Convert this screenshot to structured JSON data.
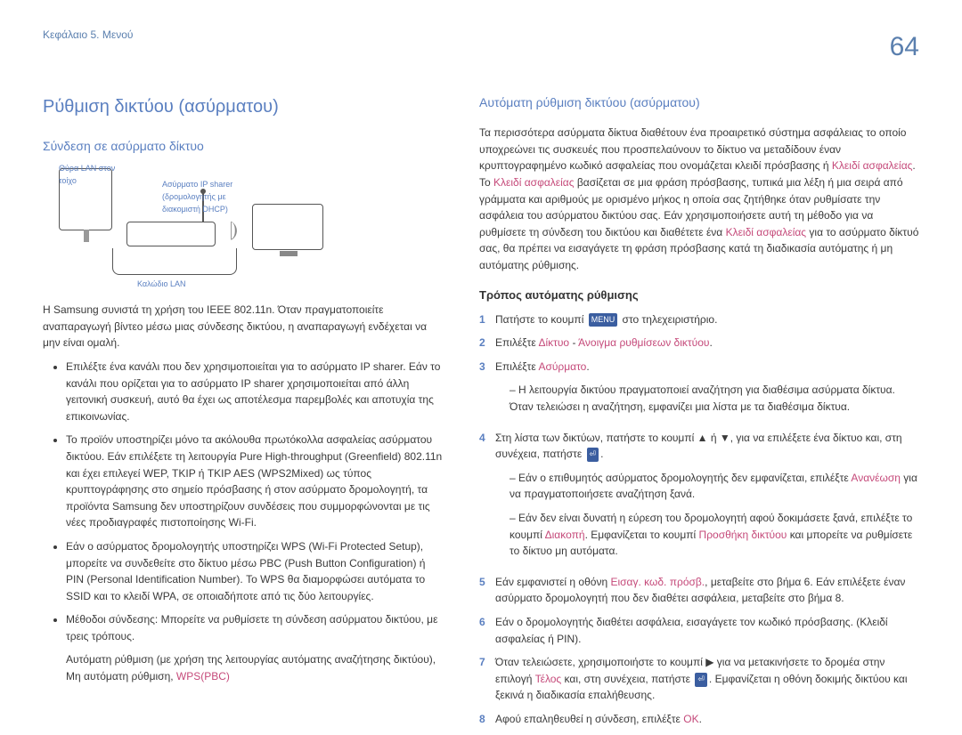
{
  "header": {
    "chapter": "Κεφάλαιο 5. Μενού",
    "page": "64"
  },
  "left": {
    "h1": "Ρύθμιση δικτύου (ασύρματου)",
    "h2": "Σύνδεση σε ασύρματο δίκτυο",
    "diag_lan_port": "Θύρα LAN στον τοίχο",
    "diag_sharer": "Ασύρματο IP sharer (δρομολογητής με διακομιστή DHCP)",
    "diag_cable": "Καλώδιο LAN",
    "p1": "Η Samsung συνιστά τη χρήση του IEEE 802.11n. Όταν πραγματοποιείτε αναπαραγωγή βίντεο μέσω μιας σύνδεσης δικτύου, η αναπαραγωγή ενδέχεται να μην είναι ομαλή.",
    "b1": "Επιλέξτε ένα κανάλι που δεν χρησιμοποιείται για το ασύρματο IP sharer. Εάν το κανάλι που ορίζεται για το ασύρματο IP sharer χρησιμοποιείται από άλλη γειτονική συσκευή, αυτό θα έχει ως αποτέλεσμα παρεμβολές και αποτυχία της επικοινωνίας.",
    "b2": "Το προϊόν υποστηρίζει μόνο τα ακόλουθα πρωτόκολλα ασφαλείας ασύρματου δικτύου. Εάν επιλέξετε τη λειτουργία Pure High-throughput (Greenfield) 802.11n και έχει επιλεγεί WEP, TKIP ή TKIP AES (WPS2Mixed) ως τύπος κρυπτογράφησης στο σημείο πρόσβασης ή στον ασύρματο δρομολογητή, τα προϊόντα Samsung δεν υποστηρίζουν συνδέσεις που συμμορφώνονται με τις νέες προδιαγραφές πιστοποίησης Wi-Fi.",
    "b3": "Εάν ο ασύρματος δρομολογητής υποστηρίζει WPS (Wi-Fi Protected Setup), μπορείτε να συνδεθείτε στο δίκτυο μέσω PBC (Push Button Configuration) ή PIN (Personal Identification Number). Το WPS θα διαμορφώσει αυτόματα το SSID και το κλειδί WPA, σε οποιαδήποτε από τις δύο λειτουργίες.",
    "b4a": "Μέθοδοι σύνδεσης: Μπορείτε να ρυθμίσετε τη σύνδεση ασύρματου δικτύου, με τρεις τρόπους.",
    "b4b_pre": "Αυτόματη ρύθμιση (με χρήση της λειτουργίας αυτόματης αναζήτησης δικτύου), Μη αυτόματη ρύθμιση, ",
    "b4b_accent": "WPS(PBC)"
  },
  "right": {
    "h2": "Αυτόματη ρύθμιση δικτύου (ασύρματου)",
    "p1_a": "Τα περισσότερα ασύρματα δίκτυα διαθέτουν ένα προαιρετικό σύστημα ασφάλειας το οποίο υποχρεώνει τις συσκευές που προσπελαύνουν το δίκτυο να μεταδίδουν έναν κρυπτογραφημένο κωδικό ασφαλείας που ονομάζεται κλειδί πρόσβασης ή ",
    "p1_b": "Κλειδί ασφαλείας",
    "p1_c": ". Το ",
    "p1_d": "Κλειδί ασφαλείας",
    "p1_e": " βασίζεται σε μια φράση πρόσβασης, τυπικά μια λέξη ή μια σειρά από γράμματα και αριθμούς με ορισμένο μήκος η οποία σας ζητήθηκε όταν ρυθμίσατε την ασφάλεια του ασύρματου δικτύου σας. Εάν χρησιμοποιήσετε αυτή τη μέθοδο για να ρυθμίσετε τη σύνδεση του δικτύου και διαθέτετε ένα ",
    "p1_f": "Κλειδί ασφαλείας",
    "p1_g": " για το ασύρματο δίκτυό σας, θα πρέπει να εισαγάγετε τη φράση πρόσβασης κατά τη διαδικασία αυτόματης ή μη αυτόματης ρύθμισης.",
    "h3": "Τρόπος αυτόματης ρύθμισης",
    "s1_a": "Πατήστε το κουμπί ",
    "s1_menu": "MENU",
    "s1_b": " στο τηλεχειριστήριο.",
    "s2_a": "Επιλέξτε ",
    "s2_net": "Δίκτυο",
    "s2_sep": " - ",
    "s2_open": "Άνοιγμα ρυθμίσεων δικτύου",
    "s2_b": ".",
    "s3_a": "Επιλέξτε ",
    "s3_wireless": "Ασύρματο",
    "s3_b": ".",
    "s3_sub": "Η λειτουργία δικτύου πραγματοποιεί αναζήτηση για διαθέσιμα ασύρματα δίκτυα. Όταν τελειώσει η αναζήτηση, εμφανίζει μια λίστα με τα διαθέσιμα δίκτυα.",
    "s4_a": "Στη λίστα των δικτύων, πατήστε το κουμπί ▲ ή ▼, για να επιλέξετε ένα δίκτυο και, στη συνέχεια, πατήστε ",
    "s4_btn": "⏎",
    "s4_b": ".",
    "s4_sub1_a": "Εάν ο επιθυμητός ασύρματος δρομολογητής δεν εμφανίζεται, επιλέξτε ",
    "s4_sub1_b": "Ανανέωση",
    "s4_sub1_c": " για να πραγματοποιήσετε αναζήτηση ξανά.",
    "s4_sub2_a": "Εάν δεν είναι δυνατή η εύρεση του δρομολογητή αφού δοκιμάσετε ξανά, επιλέξτε το κουμπί ",
    "s4_sub2_b": "Διακοπή",
    "s4_sub2_c": ". Εμφανίζεται το κουμπί ",
    "s4_sub2_d": "Προσθήκη δικτύου",
    "s4_sub2_e": " και μπορείτε να ρυθμίσετε το δίκτυο μη αυτόματα.",
    "s5_a": "Εάν εμφανιστεί η οθόνη ",
    "s5_b": "Εισαγ. κωδ. πρόσβ.",
    "s5_c": ", μεταβείτε στο βήμα 6. Εάν επιλέξετε έναν ασύρματο δρομολογητή που δεν διαθέτει ασφάλεια, μεταβείτε στο βήμα 8.",
    "s6": "Εάν ο δρομολογητής διαθέτει ασφάλεια, εισαγάγετε τον κωδικό πρόσβασης. (Κλειδί ασφαλείας ή PIN).",
    "s7_a": "Όταν τελειώσετε, χρησιμοποιήστε το κουμπί ▶ για να μετακινήσετε το δρομέα στην επιλογή ",
    "s7_b": "Τέλος",
    "s7_c": " και, στη συνέχεια, πατήστε ",
    "s7_btn": "⏎",
    "s7_d": ". Εμφανίζεται η οθόνη δοκιμής δικτύου και ξεκινά η διαδικασία επαλήθευσης.",
    "s8_a": "Αφού επαληθευθεί η σύνδεση, επιλέξτε ",
    "s8_b": "OK",
    "s8_c": "."
  }
}
